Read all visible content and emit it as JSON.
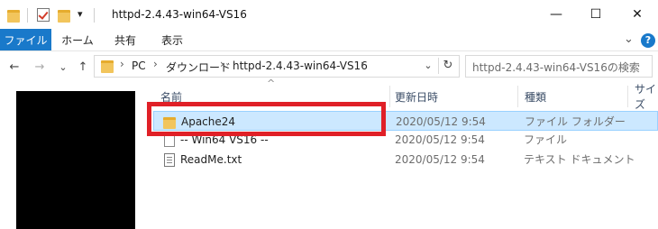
{
  "window": {
    "title": "httpd-2.4.43-win64-VS16",
    "controls": {
      "minimize": "—",
      "maximize": "☐",
      "close": "✕"
    }
  },
  "quick_access": {
    "dropdown_glyph": "▾"
  },
  "ribbon": {
    "tabs": [
      "ファイル",
      "ホーム",
      "共有",
      "表示"
    ],
    "expand_glyph": "⌄",
    "help_glyph": "?"
  },
  "nav": {
    "back": "←",
    "forward": "→",
    "recent": "⌄",
    "up": "↑",
    "refresh": "↻",
    "addr_dropdown": "⌄"
  },
  "breadcrumbs": [
    "PC",
    "ダウンロード",
    "httpd-2.4.43-win64-VS16"
  ],
  "search": {
    "placeholder": "httpd-2.4.43-win64-VS16の検索"
  },
  "columns": [
    "名前",
    "更新日時",
    "種類",
    "サイズ"
  ],
  "sort_indicator": "^",
  "files": [
    {
      "name": "Apache24",
      "modified": "2020/05/12 9:54",
      "type": "ファイル フォルダー",
      "icon": "folder-icon",
      "selected": true
    },
    {
      "name": "-- Win64 VS16 --",
      "modified": "2020/05/12 9:54",
      "type": "ファイル",
      "icon": "file-icon",
      "selected": false
    },
    {
      "name": "ReadMe.txt",
      "modified": "2020/05/12 9:54",
      "type": "テキスト ドキュメント",
      "icon": "text-file-icon",
      "selected": false
    }
  ],
  "colors": {
    "accent": "#1979ca",
    "selection": "#cce8ff",
    "annotation": "#e02027",
    "nav_pane": "#000000"
  }
}
